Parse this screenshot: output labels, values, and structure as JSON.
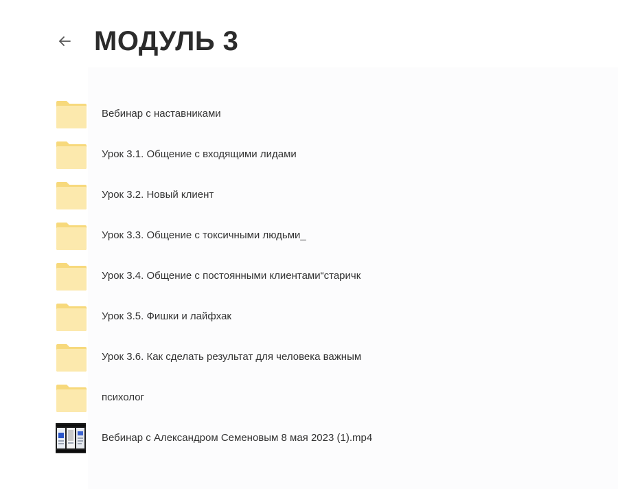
{
  "header": {
    "back_icon": "arrow-left-icon",
    "title": "МОДУЛЬ 3"
  },
  "colors": {
    "folder_body": "#fce8a9",
    "folder_back": "#f9dc88",
    "title": "#2b2b2b",
    "text": "#333333"
  },
  "items": [
    {
      "type": "folder",
      "icon": "folder-icon",
      "label": "Вебинар с наставниками"
    },
    {
      "type": "folder",
      "icon": "folder-icon",
      "label": "Урок 3.1. Общение с входящими лидами"
    },
    {
      "type": "folder",
      "icon": "folder-icon",
      "label": "Урок 3.2. Новый клиент"
    },
    {
      "type": "folder",
      "icon": "folder-icon",
      "label": "Урок 3.3. Общение с токсичными людьми_"
    },
    {
      "type": "folder",
      "icon": "folder-icon",
      "label": "Урок 3.4. Общение с постоянными клиентами“старичк"
    },
    {
      "type": "folder",
      "icon": "folder-icon",
      "label": "Урок 3.5. Фишки и лайфхак"
    },
    {
      "type": "folder",
      "icon": "folder-icon",
      "label": "Урок 3.6. Как сделать результат для человека важным"
    },
    {
      "type": "folder",
      "icon": "folder-icon",
      "label": "психолог"
    },
    {
      "type": "video",
      "icon": "video-thumbnail-icon",
      "label": "Вебинар с Александром Семеновым 8 мая 2023 (1).mp4"
    }
  ]
}
